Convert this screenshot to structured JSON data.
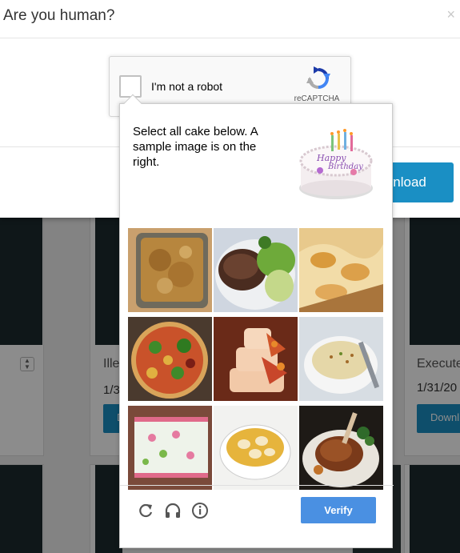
{
  "modal": {
    "title": "Are you human?",
    "close_symbol": "×",
    "download_label": "Download",
    "download_visible_label": "wnload"
  },
  "recaptcha": {
    "checkbox_label": "I'm not a robot",
    "brand": "reCAPTCHA",
    "logo_icon": "recaptcha-logo-icon"
  },
  "challenge": {
    "instructions": "Select all cake below. A sample image is on the right.",
    "sample_icon": "birthday-cake-sample-icon",
    "tiles": [
      {
        "name": "tile-casserole",
        "subject": "casserole"
      },
      {
        "name": "tile-steak-salad",
        "subject": "steak with salad"
      },
      {
        "name": "tile-baked-pastry",
        "subject": "baked pastry"
      },
      {
        "name": "tile-pizza",
        "subject": "pizza"
      },
      {
        "name": "tile-tiered-cake",
        "subject": "tiered cake"
      },
      {
        "name": "tile-soup-bowl",
        "subject": "soup"
      },
      {
        "name": "tile-sheet-cake",
        "subject": "sheet cake"
      },
      {
        "name": "tile-dumpling-soup",
        "subject": "dumpling soup"
      },
      {
        "name": "tile-roast-duck",
        "subject": "roast duck"
      }
    ],
    "reload_icon": "reload-icon",
    "audio_icon": "headphones-icon",
    "info_icon": "info-icon",
    "verify_label": "Verify"
  },
  "background": {
    "cards": [
      {
        "title": "Ille",
        "date": "1/3",
        "button": "Download"
      },
      {
        "title": "Execute",
        "date": "1/31/20",
        "button": "Downl"
      }
    ],
    "stepper_icon": "stepper-icon",
    "colors": {
      "button": "#1a8fc4",
      "verify": "#4a90e2"
    }
  }
}
